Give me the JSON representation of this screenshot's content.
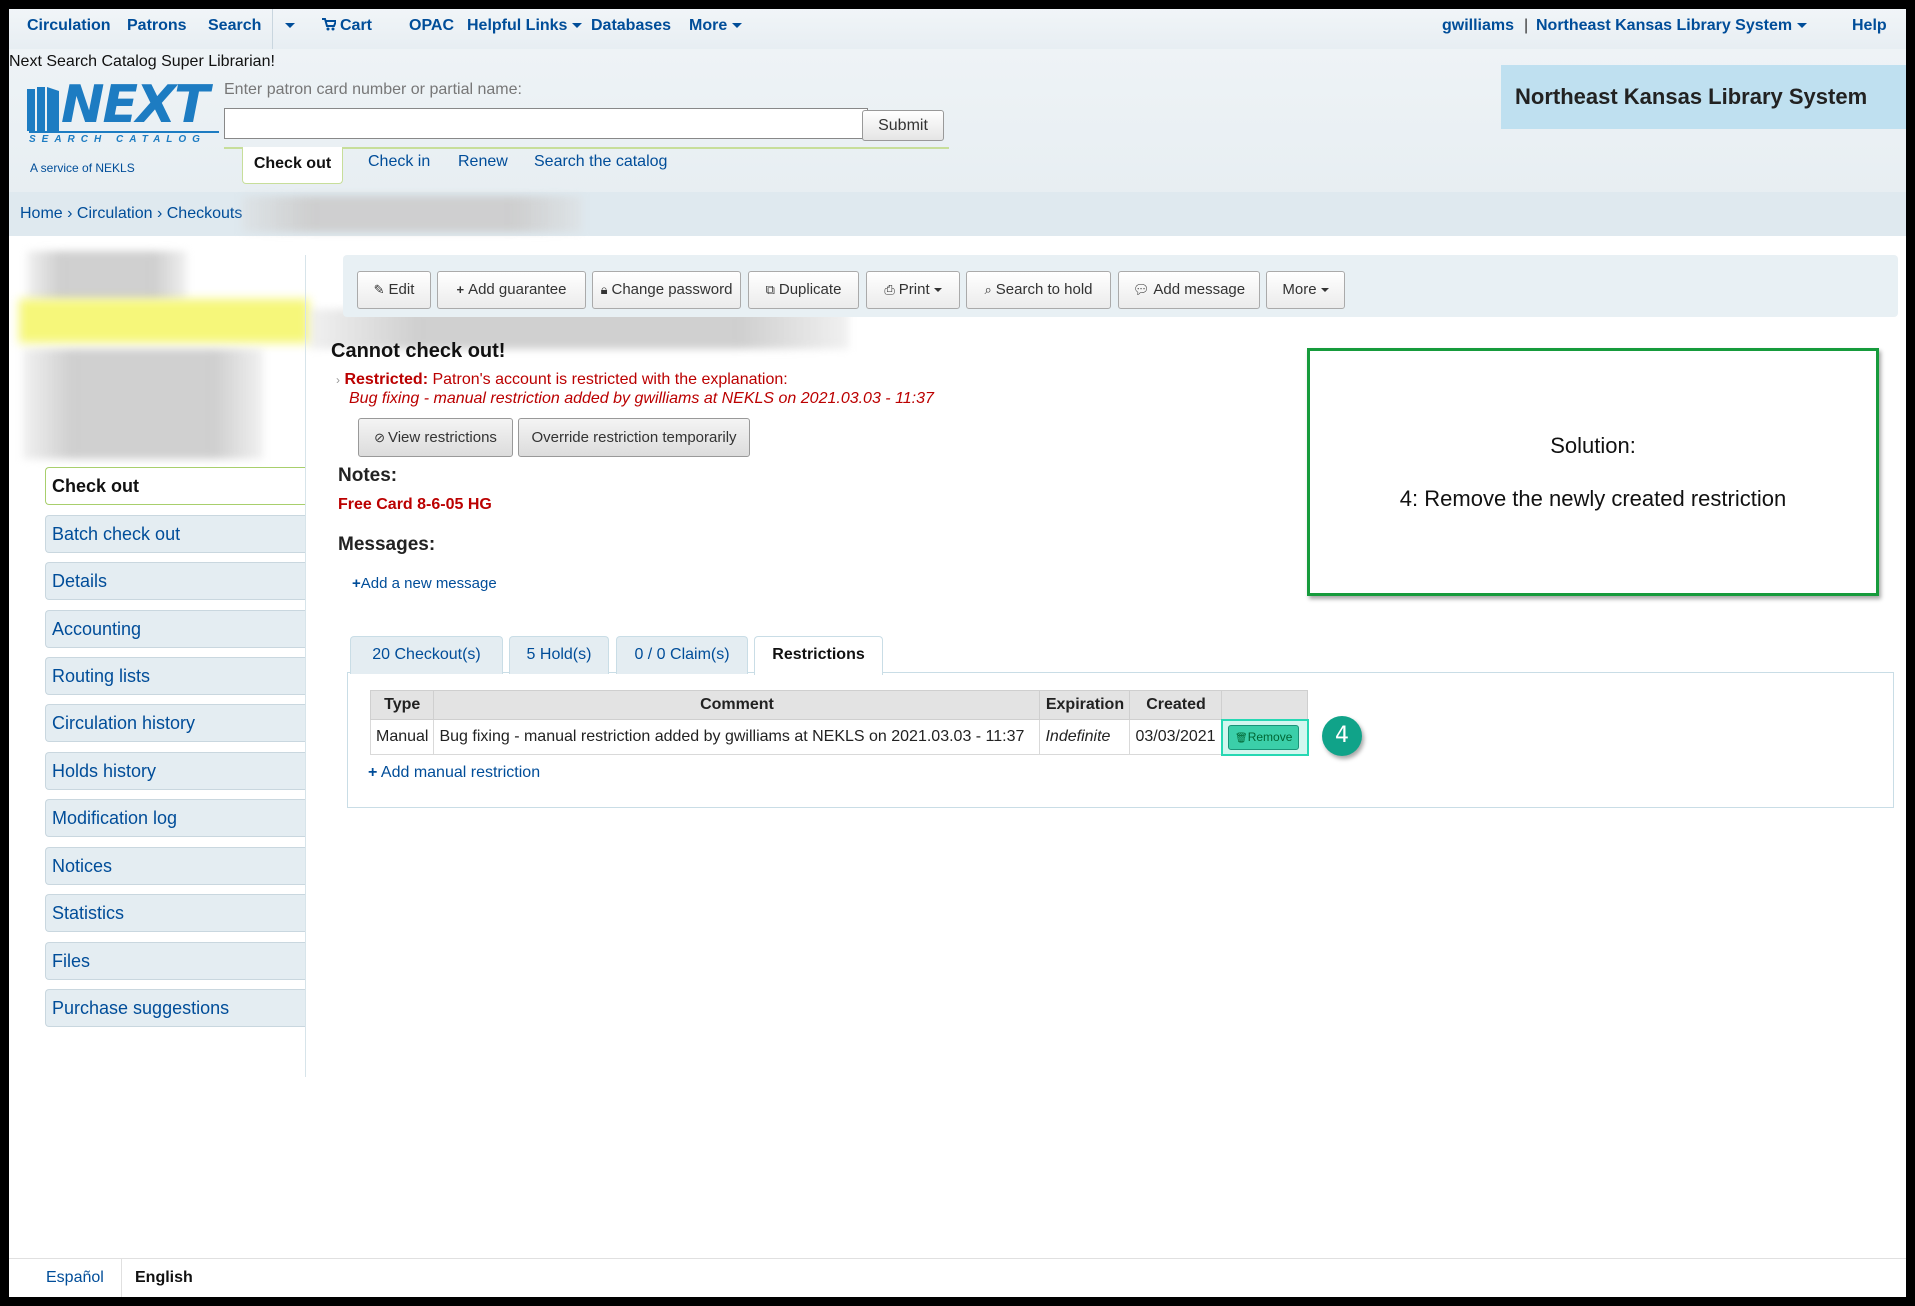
{
  "nav": {
    "items": [
      {
        "label": "Circulation"
      },
      {
        "label": "Patrons"
      },
      {
        "label": "Search"
      },
      {
        "label": "Cart"
      },
      {
        "label": "OPAC"
      },
      {
        "label": "Helpful Links"
      },
      {
        "label": "Databases"
      },
      {
        "label": "More"
      }
    ],
    "user": "gwilliams",
    "separator": "|",
    "library": "Northeast Kansas Library System",
    "help": "Help"
  },
  "header": {
    "logged_in_text": "Next Search Catalog Super Librarian!",
    "logo_text": "NEXT",
    "logo_subtitle": "SEARCH CATALOG",
    "logo_service": "A service of NEKLS",
    "patron_label": "Enter patron card number or partial name:",
    "patron_value": "",
    "submit_label": "Submit",
    "circ_tabs": [
      "Check out",
      "Check in",
      "Renew",
      "Search the catalog"
    ],
    "library_banner": "Northeast Kansas Library System"
  },
  "breadcrumb": {
    "home": "Home",
    "sep": "›",
    "circulation": "Circulation",
    "checkouts": "Checkouts"
  },
  "sidebar": {
    "items": [
      "Check out",
      "Batch check out",
      "Details",
      "Accounting",
      "Routing lists",
      "Circulation history",
      "Holds history",
      "Modification log",
      "Notices",
      "Statistics",
      "Files",
      "Purchase suggestions"
    ]
  },
  "toolbar": {
    "buttons": [
      "Edit",
      "Add guarantee",
      "Change password",
      "Duplicate",
      "Print",
      "Search to hold",
      "Add message",
      "More"
    ]
  },
  "main": {
    "cannot_checkout": "Cannot check out!",
    "restricted_label": "Restricted:",
    "restricted_text": "Patron's account is restricted with the explanation:",
    "restricted_explanation": "Bug fixing - manual restriction added by gwilliams at NEKLS on 2021.03.03 - 11:37",
    "view_restrictions": "View restrictions",
    "override_restriction": "Override restriction temporarily",
    "notes_heading": "Notes:",
    "notes_value": "Free Card 8-6-05 HG",
    "messages_heading": "Messages:",
    "add_message": "Add a new message"
  },
  "tabs": [
    "20 Checkout(s)",
    "5 Hold(s)",
    "0 / 0 Claim(s)",
    "Restrictions"
  ],
  "restrictions_table": {
    "headers": [
      "Type",
      "Comment",
      "Expiration",
      "Created",
      ""
    ],
    "rows": [
      {
        "type": "Manual",
        "comment": "Bug fixing - manual restriction added by gwilliams at NEKLS on 2021.03.03 - 11:37",
        "expiration": "Indefinite",
        "created": "03/03/2021",
        "action": "Remove"
      }
    ],
    "add_label": "Add manual restriction"
  },
  "annotation": {
    "step": "4",
    "title": "Solution:",
    "text": "4: Remove the newly created restriction",
    "box_color": "#169b3c",
    "highlight_color": "#26d8b3"
  },
  "footer": {
    "languages": [
      "Español",
      "English"
    ]
  }
}
